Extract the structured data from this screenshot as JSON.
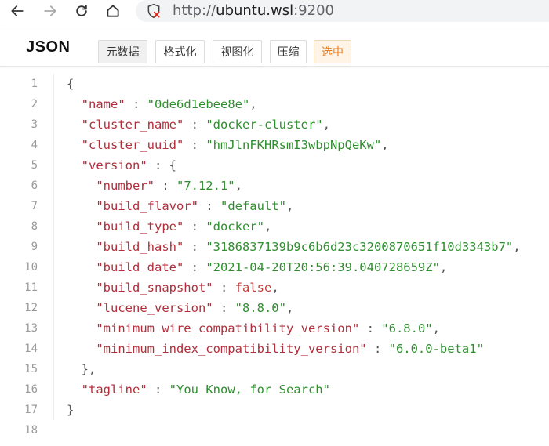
{
  "browser": {
    "url_prefix": "http://",
    "url_host": "ubuntu.wsl",
    "url_port": ":9200"
  },
  "toolbar": {
    "label": "JSON",
    "tabs": [
      "元数据",
      "格式化",
      "视图化",
      "压缩",
      "选中"
    ]
  },
  "json_lines": [
    {
      "n": "1"
    },
    {
      "n": "2"
    },
    {
      "n": "3"
    },
    {
      "n": "4"
    },
    {
      "n": "5"
    },
    {
      "n": "6"
    },
    {
      "n": "7"
    },
    {
      "n": "8"
    },
    {
      "n": "9"
    },
    {
      "n": "10"
    },
    {
      "n": "11"
    },
    {
      "n": "12"
    },
    {
      "n": "13"
    },
    {
      "n": "14"
    },
    {
      "n": "15"
    },
    {
      "n": "16"
    },
    {
      "n": "17"
    },
    {
      "n": "18"
    }
  ],
  "json": {
    "name_key": "\"name\"",
    "name_val": "\"0de6d1ebee8e\"",
    "cluster_name_key": "\"cluster_name\"",
    "cluster_name_val": "\"docker-cluster\"",
    "cluster_uuid_key": "\"cluster_uuid\"",
    "cluster_uuid_val": "\"hmJlnFKHRsmI3wbpNpQeKw\"",
    "version_key": "\"version\"",
    "number_key": "\"number\"",
    "number_val": "\"7.12.1\"",
    "build_flavor_key": "\"build_flavor\"",
    "build_flavor_val": "\"default\"",
    "build_type_key": "\"build_type\"",
    "build_type_val": "\"docker\"",
    "build_hash_key": "\"build_hash\"",
    "build_hash_val": "\"3186837139b9c6b6d23c3200870651f10d3343b7\"",
    "build_date_key": "\"build_date\"",
    "build_date_val": "\"2021-04-20T20:56:39.040728659Z\"",
    "build_snapshot_key": "\"build_snapshot\"",
    "build_snapshot_val": "false",
    "lucene_version_key": "\"lucene_version\"",
    "lucene_version_val": "\"8.8.0\"",
    "min_wire_key": "\"minimum_wire_compatibility_version\"",
    "min_wire_val": "\"6.8.0\"",
    "min_index_key": "\"minimum_index_compatibility_version\"",
    "min_index_val": "\"6.0.0-beta1\"",
    "tagline_key": "\"tagline\"",
    "tagline_val": "\"You Know, for Search\""
  }
}
